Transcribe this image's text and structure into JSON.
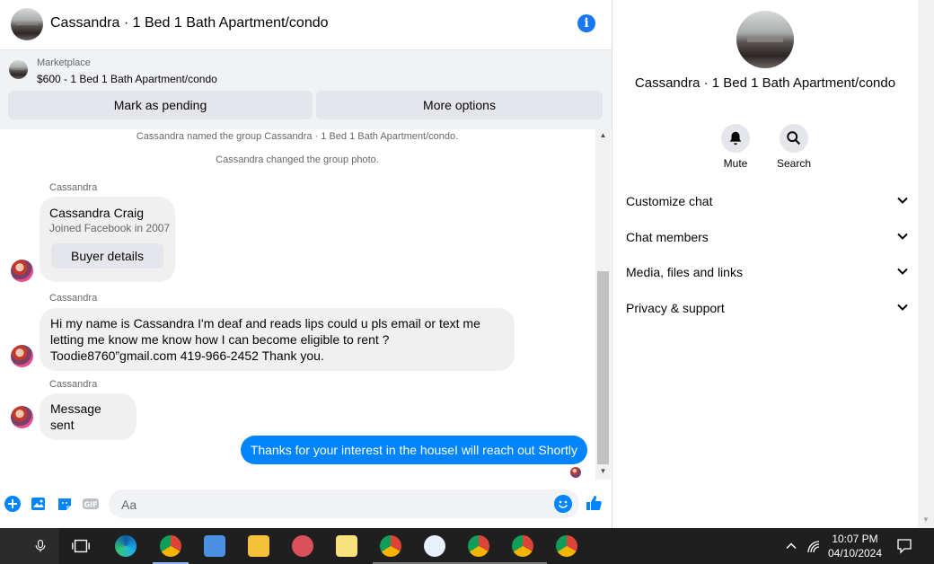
{
  "header": {
    "title": "Cassandra · 1 Bed 1 Bath Apartment/condo"
  },
  "listing": {
    "source": "Marketplace",
    "price_title": "$600 - 1 Bed 1 Bath Apartment/condo",
    "mark_pending_label": "Mark as pending",
    "more_options_label": "More options"
  },
  "messages": {
    "system": [
      "Cassandra named the group Cassandra · 1 Bed 1 Bath Apartment/condo.",
      "Cassandra changed the group photo."
    ],
    "sender_name": "Cassandra",
    "profile_card": {
      "name": "Cassandra Craig",
      "joined": "Joined Facebook in 2007",
      "button": "Buyer details"
    },
    "incoming_1": "Hi my name is Cassandra I'm deaf and reads lips could u pls email or text me letting me know me know how I can become eligible to rent ? Toodie8760”gmail.com    419-966-2452 Thank you.",
    "incoming_2": "Message sent",
    "outgoing_1": "Thanks for your interest in the houseI will reach out Shortly"
  },
  "composer": {
    "placeholder": "Aa"
  },
  "info_panel": {
    "name": "Cassandra · 1 Bed 1 Bath Apartment/condo",
    "mute_label": "Mute",
    "search_label": "Search",
    "sections": [
      "Customize chat",
      "Chat members",
      "Media, files and links",
      "Privacy & support"
    ]
  },
  "taskbar": {
    "time": "10:07 PM",
    "date": "04/10/2024"
  },
  "colors": {
    "accent": "#1877f2",
    "outgoing_bubble": "#0084ff",
    "bubble": "#f0f0f0",
    "panel": "#f0f2f5"
  }
}
